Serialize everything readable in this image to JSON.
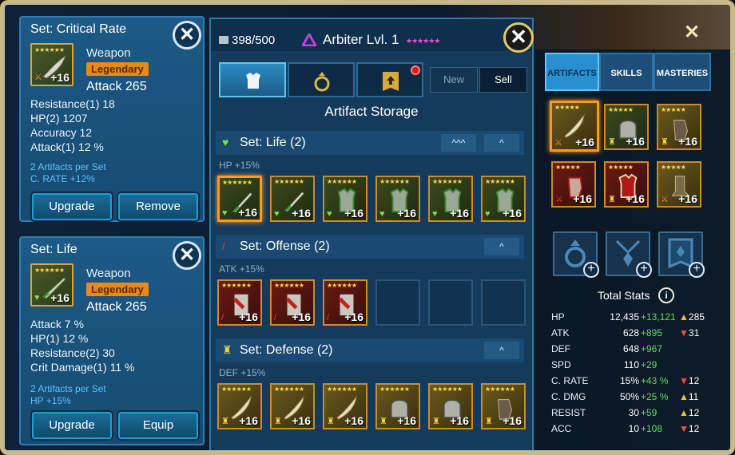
{
  "card1": {
    "title": "Set: Critical Rate",
    "kind": "Weapon",
    "rarity": "Legendary",
    "primary": "Attack 265",
    "level": "+16",
    "stars": "★★★★★★",
    "substats": [
      "Resistance(1)  18",
      "HP(2)  1207",
      "Accuracy  12",
      "Attack(1)  12 %"
    ],
    "bonus_line1": "2 Artifacts per Set",
    "bonus_line2": "C. RATE +12%",
    "btn_left": "Upgrade",
    "btn_right": "Remove"
  },
  "card2": {
    "title": "Set: Life",
    "kind": "Weapon",
    "rarity": "Legendary",
    "primary": "Attack 265",
    "level": "+16",
    "stars": "★★★★★★",
    "substats": [
      "Attack  7 %",
      "HP(1)  12 %",
      "Resistance(2)  30",
      "Crit Damage(1)  11 %"
    ],
    "bonus_line1": "2 Artifacts per Set",
    "bonus_line2": "HP +15%",
    "btn_left": "Upgrade",
    "btn_right": "Equip"
  },
  "storage": {
    "capacity": "398/500",
    "champion": "Arbiter Lvl. 1",
    "champion_stars": "★★★★★★",
    "toggle_new": "New",
    "toggle_sell": "Sell",
    "title": "Artifact Storage",
    "sets": [
      {
        "name": "Set: Life (2)",
        "bonus": "HP +15%",
        "chev1": "^^^",
        "chev2": "^"
      },
      {
        "name": "Set: Offense (2)",
        "bonus": "ATK +15%",
        "chev2": "^"
      },
      {
        "name": "Set: Defense (2)",
        "bonus": "DEF +15%",
        "chev2": "^"
      }
    ],
    "tile_level": "+16",
    "tile_stars": "★★★★★★"
  },
  "hero": {
    "tabs": [
      "ARTIFACTS",
      "SKILLS",
      "MASTERIES"
    ],
    "total_title": "Total Stats",
    "stats": [
      {
        "k": "HP",
        "v": "12,435",
        "g": "+13,121",
        "d": "285",
        "dir": "up"
      },
      {
        "k": "ATK",
        "v": "628",
        "g": "+895",
        "d": "31",
        "dir": "down"
      },
      {
        "k": "DEF",
        "v": "648",
        "g": "+967",
        "d": "",
        "dir": ""
      },
      {
        "k": "SPD",
        "v": "110",
        "g": "+29",
        "d": "",
        "dir": ""
      },
      {
        "k": "C. RATE",
        "v": "15%",
        "g": "+43 %",
        "d": "12",
        "dir": "down"
      },
      {
        "k": "C. DMG",
        "v": "50%",
        "g": "+25 %",
        "d": "11",
        "dir": "up"
      },
      {
        "k": "RESIST",
        "v": "30",
        "g": "+59",
        "d": "12",
        "dir": "up"
      },
      {
        "k": "ACC",
        "v": "10",
        "g": "+108",
        "d": "12",
        "dir": "down"
      }
    ],
    "slot_level": "+16",
    "slot_stars": "★★★★★"
  },
  "colors": {
    "accent": "#2a8fd0",
    "legendary": "#e88a1a",
    "gain": "#56e25a",
    "loss": "#ff4a4a",
    "up": "#f0c030"
  }
}
